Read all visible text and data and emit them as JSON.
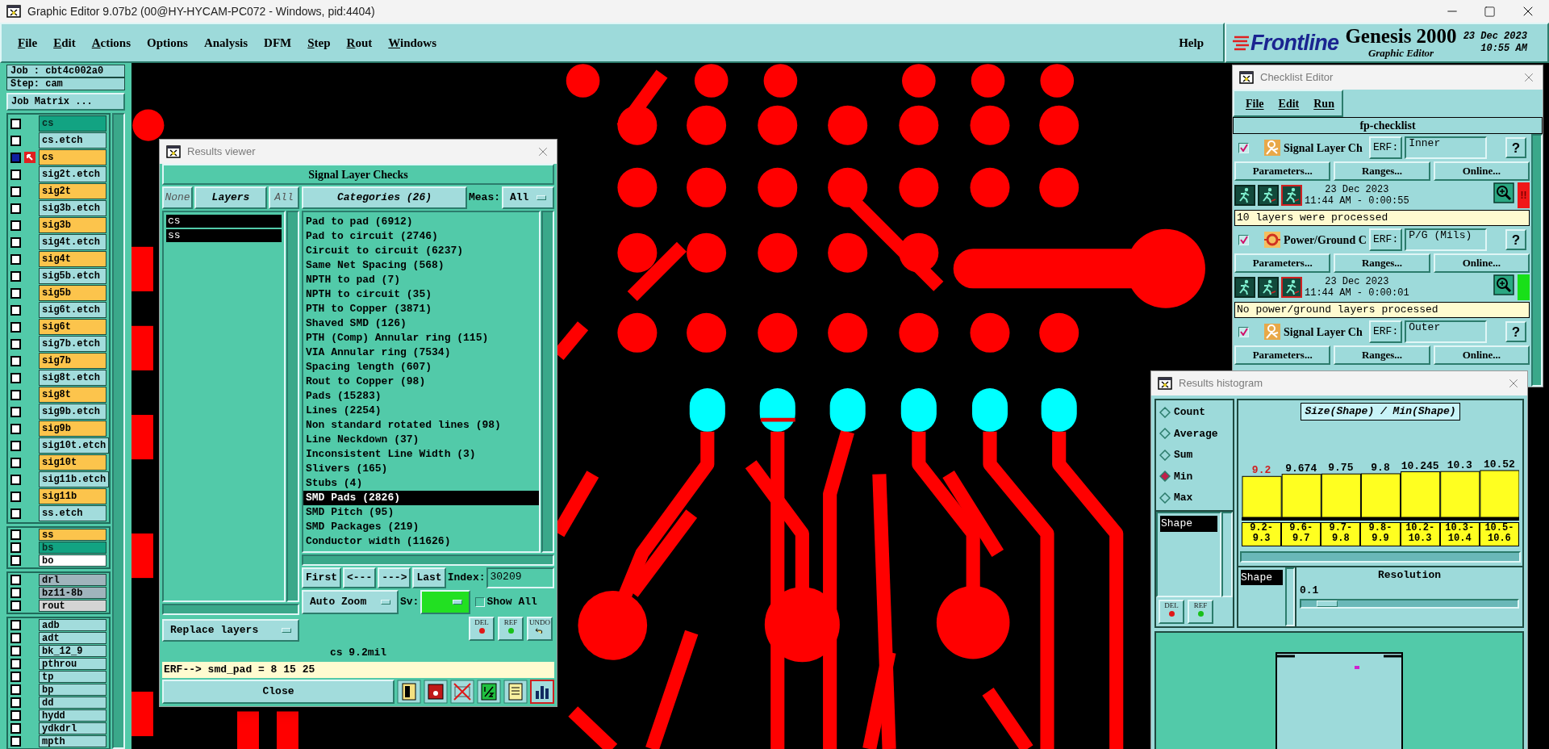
{
  "window": {
    "title": "Graphic Editor 9.07b2 (00@HY-HYCAM-PC072 - Windows, pid:4404)"
  },
  "menu": [
    {
      "label": "File",
      "mnemonic": true
    },
    {
      "label": "Edit",
      "mnemonic": true
    },
    {
      "label": "Actions",
      "mnemonic": true
    },
    {
      "label": "Options",
      "mnemonic": false
    },
    {
      "label": "Analysis",
      "mnemonic": false
    },
    {
      "label": "DFM",
      "mnemonic": false
    },
    {
      "label": "Step",
      "mnemonic": true
    },
    {
      "label": "Rout",
      "mnemonic": true
    },
    {
      "label": "Windows",
      "mnemonic": true
    }
  ],
  "help_menu": "Help",
  "brand": {
    "logo": "Frontline",
    "product": "Genesis 2000",
    "subtitle": "Graphic Editor",
    "date": "23 Dec 2023",
    "time": "10:55 AM"
  },
  "job_panel": {
    "job": "Job : cbt4c002a0",
    "step": "Step: cam",
    "job_matrix": "Job Matrix ..."
  },
  "layer_groups": [
    [
      {
        "name": "cs",
        "color": "#12a382",
        "selected": false
      },
      {
        "name": "cs.etch",
        "color": "#a2dcdc",
        "selected": false
      },
      {
        "name": "cs",
        "color": "#fcc44c",
        "selected": true
      },
      {
        "name": "sig2t.etch",
        "color": "#a2dcdc",
        "selected": false
      },
      {
        "name": "sig2t",
        "color": "#fcc44c",
        "selected": false
      },
      {
        "name": "sig3b.etch",
        "color": "#a2dcdc",
        "selected": false
      },
      {
        "name": "sig3b",
        "color": "#fcc44c",
        "selected": false
      },
      {
        "name": "sig4t.etch",
        "color": "#a2dcdc",
        "selected": false
      },
      {
        "name": "sig4t",
        "color": "#fcc44c",
        "selected": false
      },
      {
        "name": "sig5b.etch",
        "color": "#a2dcdc",
        "selected": false
      },
      {
        "name": "sig5b",
        "color": "#fcc44c",
        "selected": false
      },
      {
        "name": "sig6t.etch",
        "color": "#a2dcdc",
        "selected": false
      },
      {
        "name": "sig6t",
        "color": "#fcc44c",
        "selected": false
      },
      {
        "name": "sig7b.etch",
        "color": "#a2dcdc",
        "selected": false
      },
      {
        "name": "sig7b",
        "color": "#fcc44c",
        "selected": false
      },
      {
        "name": "sig8t.etch",
        "color": "#a2dcdc",
        "selected": false
      },
      {
        "name": "sig8t",
        "color": "#fcc44c",
        "selected": false
      },
      {
        "name": "sig9b.etch",
        "color": "#a2dcdc",
        "selected": false
      },
      {
        "name": "sig9b",
        "color": "#fcc44c",
        "selected": false
      },
      {
        "name": "sig10t.etch",
        "color": "#a2dcdc",
        "selected": false
      },
      {
        "name": "sig10t",
        "color": "#fcc44c",
        "selected": false
      },
      {
        "name": "sig11b.etch",
        "color": "#a2dcdc",
        "selected": false
      },
      {
        "name": "sig11b",
        "color": "#fcc44c",
        "selected": false
      },
      {
        "name": "ss.etch",
        "color": "#a2dcdc",
        "selected": false
      }
    ],
    [
      {
        "name": "ss",
        "color": "#fcc44c",
        "selected": false
      },
      {
        "name": "bs",
        "color": "#12a382",
        "selected": false
      },
      {
        "name": "bo",
        "color": "#ffffff",
        "selected": false
      }
    ],
    [
      {
        "name": "drl",
        "color": "#a0b4bc",
        "selected": false
      },
      {
        "name": "bz11-8b",
        "color": "#a0b4bc",
        "selected": false
      },
      {
        "name": "rout",
        "color": "#d4d4d4",
        "selected": false
      }
    ],
    [
      {
        "name": "adb",
        "color": "#a2dcdc",
        "selected": false
      },
      {
        "name": "adt",
        "color": "#a2dcdc",
        "selected": false
      },
      {
        "name": "bk_12_9",
        "color": "#a2dcdc",
        "selected": false
      },
      {
        "name": "pthrou",
        "color": "#a2dcdc",
        "selected": false
      },
      {
        "name": "tp",
        "color": "#a2dcdc",
        "selected": false
      },
      {
        "name": "bp",
        "color": "#a2dcdc",
        "selected": false
      },
      {
        "name": "dd",
        "color": "#a2dcdc",
        "selected": false
      },
      {
        "name": "hydd",
        "color": "#a2dcdc",
        "selected": false
      },
      {
        "name": "ydkdrl",
        "color": "#a2dcdc",
        "selected": false
      },
      {
        "name": "mpth",
        "color": "#a2dcdc",
        "selected": false
      }
    ]
  ],
  "results_viewer": {
    "title": "Results viewer",
    "header": "Signal Layer Checks",
    "layer_buttons": [
      {
        "label": "None",
        "disabled": true
      },
      {
        "label": "Layers",
        "disabled": false
      },
      {
        "label": "All",
        "disabled": true
      }
    ],
    "layers": [
      {
        "name": "cs",
        "selected": true
      },
      {
        "name": "ss",
        "selected": true
      }
    ],
    "categories_button": "Categories (26)",
    "meas_label": "Meas:",
    "meas_value": "All",
    "categories": [
      {
        "label": "Pad to pad (6912)",
        "selected": false
      },
      {
        "label": "Pad to circuit (2746)",
        "selected": false
      },
      {
        "label": "Circuit to circuit (6237)",
        "selected": false
      },
      {
        "label": "Same Net Spacing (568)",
        "selected": false
      },
      {
        "label": "NPTH to pad (7)",
        "selected": false
      },
      {
        "label": "NPTH to circuit (35)",
        "selected": false
      },
      {
        "label": "PTH to Copper (3871)",
        "selected": false
      },
      {
        "label": "Shaved SMD (126)",
        "selected": false
      },
      {
        "label": "PTH (Comp) Annular ring (115)",
        "selected": false
      },
      {
        "label": "VIA Annular ring (7534)",
        "selected": false
      },
      {
        "label": "Spacing length (607)",
        "selected": false
      },
      {
        "label": "Rout to Copper (98)",
        "selected": false
      },
      {
        "label": "Pads (15283)",
        "selected": false
      },
      {
        "label": "Lines (2254)",
        "selected": false
      },
      {
        "label": "Non standard rotated lines (98)",
        "selected": false
      },
      {
        "label": "Line Neckdown (37)",
        "selected": false
      },
      {
        "label": "Inconsistent Line Width (3)",
        "selected": false
      },
      {
        "label": "Slivers (165)",
        "selected": false
      },
      {
        "label": "Stubs (4)",
        "selected": false
      },
      {
        "label": "SMD Pads (2826)",
        "selected": true
      },
      {
        "label": "SMD Pitch (95)",
        "selected": false
      },
      {
        "label": "SMD Packages (219)",
        "selected": false
      },
      {
        "label": "Conductor width (11626)",
        "selected": false
      }
    ],
    "nav_buttons": [
      "First",
      "<---",
      "--->",
      "Last"
    ],
    "index_label": "Index:",
    "index_value": "30209",
    "zoom_mode": "Auto Zoom",
    "sv_label": "Sv:",
    "show_all": {
      "label": "Show All",
      "checked": false
    },
    "replace_mode": "Replace layers",
    "edit_buttons": [
      {
        "label": "DEL",
        "kind": "delete"
      },
      {
        "label": "REF",
        "kind": "reference"
      },
      {
        "label": "UNDO",
        "kind": "undo"
      }
    ],
    "status": "cs 9.2mil",
    "erf_line": "ERF--> smd_pad = 8 15 25",
    "close": "Close"
  },
  "checklist_editor": {
    "title": "Checklist Editor",
    "menu": [
      "File",
      "Edit",
      "Run"
    ],
    "checklist": "fp-checklist",
    "actions": [
      {
        "checked": true,
        "kind": "signal",
        "name": "Signal Layer Ch",
        "erf_label": "ERF:",
        "erf": "Inner",
        "help": "?",
        "buttons": [
          "Parameters...",
          "Ranges...",
          "Online..."
        ],
        "date": "23 Dec 2023",
        "time": "11:44 AM - 0:00:55",
        "color": "#f01818",
        "status_mark": "!!",
        "message": "10 layers were processed"
      },
      {
        "checked": true,
        "kind": "power",
        "name": "Power/Ground C",
        "erf_label": "ERF:",
        "erf": "P/G (Mils)",
        "help": "?",
        "buttons": [
          "Parameters...",
          "Ranges...",
          "Online..."
        ],
        "date": "23 Dec 2023",
        "time": "11:44 AM - 0:00:01",
        "color": "#18e018",
        "message": "No power/ground layers processed"
      },
      {
        "checked": true,
        "kind": "signal",
        "name": "Signal Layer Ch",
        "erf_label": "ERF:",
        "erf": "Outer",
        "help": "?",
        "buttons": [
          "Parameters...",
          "Ranges...",
          "Online..."
        ]
      }
    ]
  },
  "results_histogram": {
    "title": "Results histogram",
    "modes": [
      {
        "label": "Count",
        "selected": false
      },
      {
        "label": "Average",
        "selected": false
      },
      {
        "label": "Sum",
        "selected": false
      },
      {
        "label": "Min",
        "selected": true
      },
      {
        "label": "Max",
        "selected": false
      }
    ],
    "attributes": [
      {
        "label": "Shape",
        "selected": true
      }
    ],
    "edit_buttons": [
      {
        "label": "DEL",
        "kind": "delete"
      },
      {
        "label": "REF",
        "kind": "reference"
      }
    ],
    "chart_data": {
      "type": "bar",
      "title": "Size(Shape) / Min(Shape)",
      "categories": [
        "9.2-9.3",
        "9.6-9.7",
        "9.7-9.8",
        "9.8-9.9",
        "10.2-10.3",
        "10.3-10.4",
        "10.5-10.6"
      ],
      "values": [
        9.2,
        9.674,
        9.75,
        9.8,
        10.245,
        10.3,
        10.52
      ],
      "value_labels": [
        "9.2",
        "9.674",
        "9.75",
        "9.8",
        "10.245",
        "10.3",
        "10.52"
      ],
      "data_labels": true
    },
    "group_list": [
      {
        "label": "Shape",
        "selected": true
      }
    ],
    "resolution_label": "Resolution",
    "resolution_value": "0.1",
    "resolution": {
      "level": 0.07
    }
  }
}
